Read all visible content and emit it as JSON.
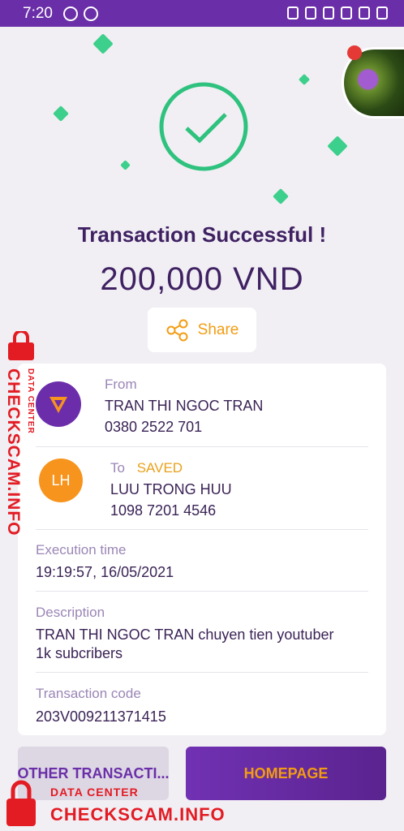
{
  "status_bar": {
    "time": "7:20"
  },
  "header": {
    "title": "Transaction Successful !",
    "amount": "200,000 VND",
    "share_label": "Share"
  },
  "from": {
    "label": "From",
    "name": "TRAN THI NGOC TRAN",
    "phone": "0380 2522 701"
  },
  "to": {
    "label": "To",
    "badge": "SAVED",
    "initials": "LH",
    "name": "LUU TRONG HUU",
    "phone": "1098 7201 4546"
  },
  "execution": {
    "label": "Execution time",
    "value": "19:19:57,  16/05/2021"
  },
  "description": {
    "label": "Description",
    "line1": "TRAN THI NGOC TRAN chuyen tien youtuber",
    "line2": "1k subcribers"
  },
  "transaction_code": {
    "label": "Transaction code",
    "value": "203V009211371415"
  },
  "buttons": {
    "other": "OTHER TRANSACTI...",
    "home": "HOMEPAGE"
  },
  "watermark": {
    "small": "DATA CENTER",
    "main": "CHECKSCAM.INFO"
  },
  "colors": {
    "accent": "#6a2fa8",
    "success": "#2ec27e",
    "orange": "#f39c12"
  }
}
